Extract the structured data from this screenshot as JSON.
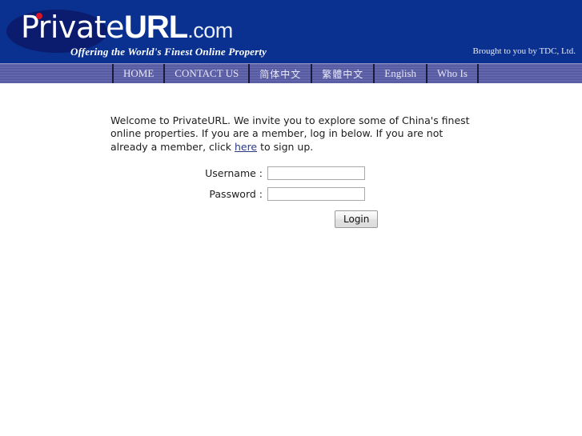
{
  "header": {
    "logo": {
      "part_script": "Private",
      "part_bold": "URL",
      "part_tld": ".com",
      "tagline": "Offering the World's Finest Online Property"
    },
    "credit": "Brought to you by TDC, Ltd.",
    "colors": {
      "banner_bg": "#0a3190",
      "ellipse": "#0b1c6e",
      "dot": "#d8132a",
      "navbar_bg": "#5b5ea5",
      "nav_text": "#e6e6f7",
      "link": "#2b3a80"
    }
  },
  "nav": {
    "items": [
      {
        "label": "HOME",
        "script": "latin"
      },
      {
        "label": "CONTACT US",
        "script": "latin"
      },
      {
        "label": "简体中文",
        "script": "cjk"
      },
      {
        "label": "繁體中文",
        "script": "cjk"
      },
      {
        "label": "English",
        "script": "latin"
      },
      {
        "label": "Who Is",
        "script": "latin"
      }
    ]
  },
  "main": {
    "welcome": {
      "text_before_link": "Welcome to PrivateURL. We invite you to explore some of China's finest online properties. If you are a member, log in below. If you are not already a member, click ",
      "link_text": "here",
      "text_after_link": " to sign up."
    },
    "form": {
      "username_label": "Username :",
      "username_value": "",
      "username_placeholder": "",
      "password_label": "Password :",
      "password_value": "",
      "password_placeholder": "",
      "submit_label": "Login"
    }
  }
}
